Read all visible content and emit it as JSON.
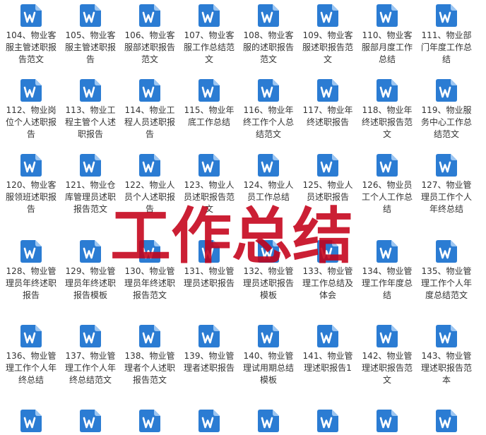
{
  "icon": {
    "name": "word-document-icon",
    "color": "#2b7cd3",
    "fold_color": "#9cc6f2"
  },
  "watermark": {
    "text": "工作总结",
    "color": "#c40018"
  },
  "files": [
    {
      "label": "104、物业客服主管述职报告范文"
    },
    {
      "label": "105、物业客服主管述职报告"
    },
    {
      "label": "106、物业客服部述职报告范文"
    },
    {
      "label": "107、物业客服工作总结范文"
    },
    {
      "label": "108、物业客服的述职报告范文"
    },
    {
      "label": "109、物业客服述职报告范文"
    },
    {
      "label": "110、物业客服部月度工作总结"
    },
    {
      "label": "111、物业部门年度工作总结"
    },
    {
      "label": "112、物业岗位个人述职报告"
    },
    {
      "label": "113、物业工程主管个人述职报告"
    },
    {
      "label": "114、物业工程人员述职报告"
    },
    {
      "label": "115、物业年底工作总结"
    },
    {
      "label": "116、物业年终工作个人总结范文"
    },
    {
      "label": "117、物业年终述职报告"
    },
    {
      "label": "118、物业年终述职报告范文"
    },
    {
      "label": "119、物业服务中心工作总结范文"
    },
    {
      "label": "120、物业客服领班述职报告"
    },
    {
      "label": "121、物业仓库管理员述职报告范文"
    },
    {
      "label": "122、物业人员个人述职报告"
    },
    {
      "label": "123、物业人员述职报告范文"
    },
    {
      "label": "124、物业人员工作总结"
    },
    {
      "label": "125、物业人员述职报告"
    },
    {
      "label": "126、物业员工个人工作总结"
    },
    {
      "label": "127、物业管理员工作个人年终总结"
    },
    {
      "label": "128、物业管理员年终述职报告"
    },
    {
      "label": "129、物业管理员年终述职报告模板"
    },
    {
      "label": "130、物业管理员年终述职报告范文"
    },
    {
      "label": "131、物业管理员述职报告"
    },
    {
      "label": "132、物业管理员述职报告模板"
    },
    {
      "label": "133、物业管理工作总结及体会"
    },
    {
      "label": "134、物业管理工作年度总结"
    },
    {
      "label": "135、物业管理工作个人年度总结范文"
    },
    {
      "label": "136、物业管理工作个人年终总结"
    },
    {
      "label": "137、物业管理工作个人年终总结范文"
    },
    {
      "label": "138、物业管理者个人述职报告范文"
    },
    {
      "label": "139、物业管理者述职报告"
    },
    {
      "label": "140、物业管理试用期总结模板"
    },
    {
      "label": "141、物业管理述职报告1"
    },
    {
      "label": "142、物业管理述职报告范文"
    },
    {
      "label": "143、物业管理述职报告范本"
    },
    {
      "label": ""
    },
    {
      "label": ""
    },
    {
      "label": ""
    },
    {
      "label": ""
    },
    {
      "label": ""
    },
    {
      "label": ""
    },
    {
      "label": ""
    },
    {
      "label": ""
    }
  ]
}
